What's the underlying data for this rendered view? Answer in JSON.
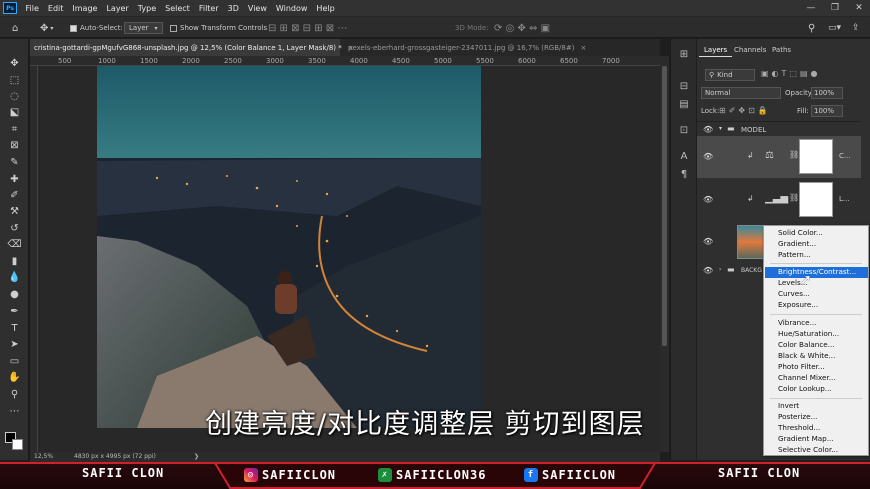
{
  "menubar": {
    "logo": "Ps",
    "items": [
      "File",
      "Edit",
      "Image",
      "Layer",
      "Type",
      "Select",
      "Filter",
      "3D",
      "View",
      "Window",
      "Help"
    ],
    "window_buttons": [
      "—",
      "❐",
      "✕"
    ]
  },
  "options": {
    "auto_select_label": "Auto-Select:",
    "auto_select_value": "Layer",
    "transform_label": "Show Transform Controls",
    "mode_3d": "3D Mode:"
  },
  "tabs": [
    {
      "label": "cristina-gottardi-gpMgufvG868-unsplash.jpg @ 12,5% (Color Balance 1, Layer Mask/8) *",
      "close": "×"
    },
    {
      "label": "pexels-eberhard-grossgasteiger-2347011.jpg @ 16,7% (RGB/8#)",
      "close": "×"
    }
  ],
  "ruler": {
    "marks": [
      "500",
      "1000",
      "1500",
      "2000",
      "2500",
      "3000",
      "3500",
      "4000",
      "4500",
      "5000",
      "5500",
      "6000",
      "6500",
      "7000"
    ]
  },
  "status": {
    "zoom": "12,5%",
    "doc": "4830 px x 4995 px (72 ppi)"
  },
  "layers_panel": {
    "tabs": [
      "Layers",
      "Channels",
      "Paths"
    ],
    "filter": "Kind",
    "blend_mode": "Normal",
    "opacity_label": "Opacity:",
    "opacity": "100%",
    "lock_label": "Lock:",
    "fill_label": "Fill:",
    "fill": "100%",
    "group_name": "MODEL",
    "layer1_name": "C...",
    "layer2_name": "L...",
    "bg_name": "BACKG"
  },
  "context_menu": {
    "group1": [
      "Solid Color...",
      "Gradient...",
      "Pattern..."
    ],
    "group2": [
      "Brightness/Contrast...",
      "Levels...",
      "Curves...",
      "Exposure..."
    ],
    "group3": [
      "Vibrance...",
      "Hue/Saturation...",
      "Color Balance...",
      "Black & White...",
      "Photo Filter...",
      "Channel Mixer...",
      "Color Lookup..."
    ],
    "group4": [
      "Invert",
      "Posterize...",
      "Threshold...",
      "Gradient Map...",
      "Selective Color..."
    ],
    "highlighted": "Brightness/Contrast..."
  },
  "subtitle": "创建亮度/对比度调整层 剪切到图层",
  "banner": {
    "left_name": "SAFII CLON",
    "instagram": "SAFIICLON",
    "other": "SAFIICLON36",
    "facebook": "SAFIICLON",
    "right_name": "SAFII CLON",
    "accent": "#d11f2e"
  }
}
